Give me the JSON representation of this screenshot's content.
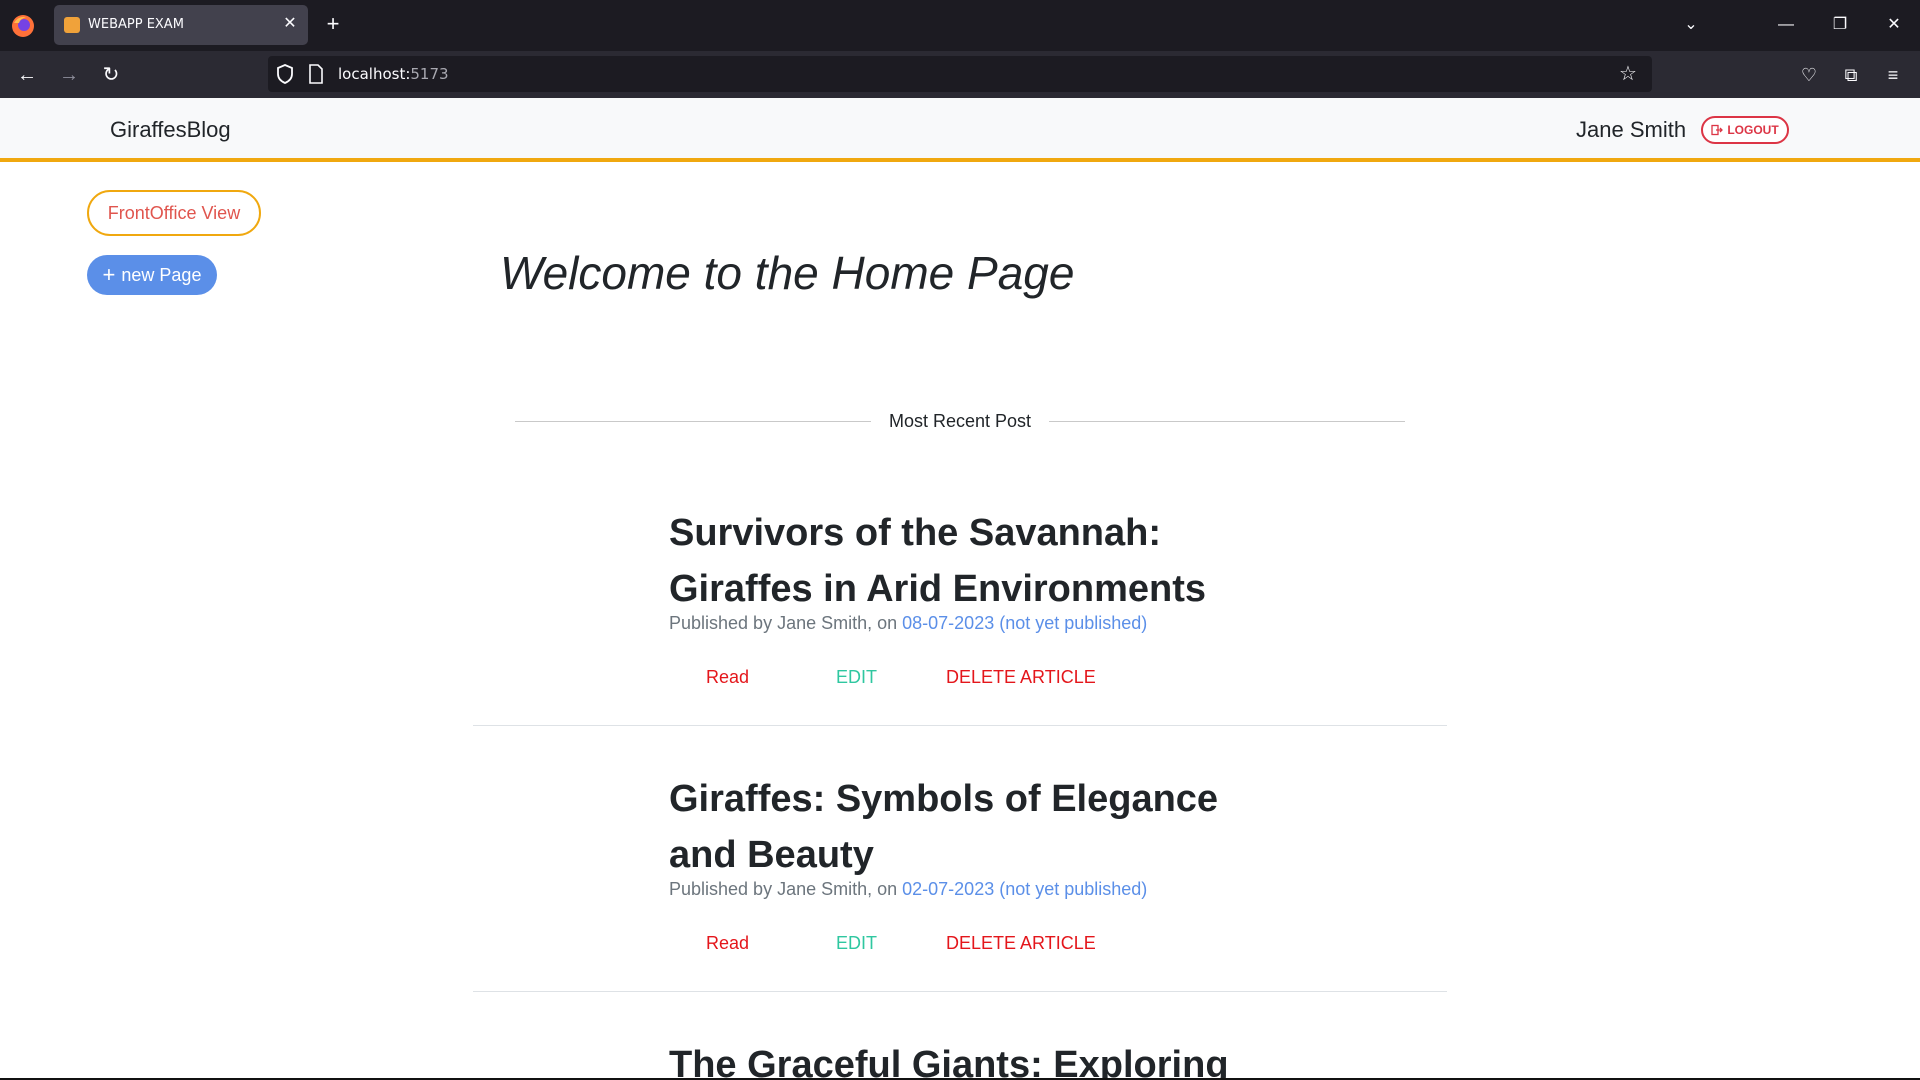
{
  "browser": {
    "tab_title": "WEBAPP EXAM",
    "url_host": "localhost:",
    "url_port": "5173",
    "icons": {
      "new_tab": "plus-icon",
      "tab_list": "chevron-down-icon",
      "minimize": "minimize-icon",
      "restore": "restore-icon",
      "close": "close-icon"
    }
  },
  "header": {
    "brand": "GiraffesBlog",
    "user_name": "Jane Smith",
    "logout_label": "LOGOUT"
  },
  "sidebar": {
    "frontoffice_label": "FrontOffice View",
    "new_page_label": "new Page"
  },
  "main": {
    "welcome": "Welcome to the Home Page",
    "section_label": "Most Recent Post",
    "posts": [
      {
        "title": "Survivors of the Savannah: Giraffes in Arid Environments",
        "meta_prefix": "Published by Jane Smith, on ",
        "date": "08-07-2023 (not yet published)",
        "read": "Read",
        "edit": "EDIT",
        "delete": "DELETE ARTICLE"
      },
      {
        "title": "Giraffes: Symbols of Elegance and Beauty",
        "meta_prefix": "Published by Jane Smith, on ",
        "date": "02-07-2023 (not yet published)",
        "read": "Read",
        "edit": "EDIT",
        "delete": "DELETE ARTICLE"
      },
      {
        "title": "The Graceful Giants: Exploring"
      }
    ]
  },
  "colors": {
    "accent": "#f0a80f",
    "primary": "#5b8fe8",
    "danger": "#e4161b",
    "success": "#2fc7a0"
  }
}
